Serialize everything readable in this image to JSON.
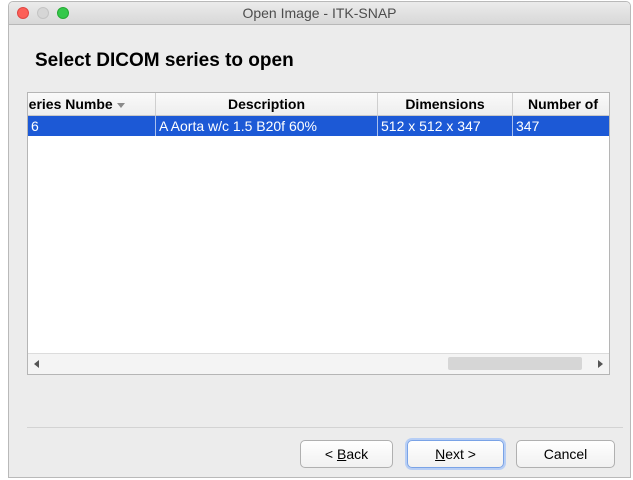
{
  "window": {
    "title": "Open Image - ITK-SNAP"
  },
  "page": {
    "heading": "Select DICOM series to open"
  },
  "table": {
    "columns": [
      "Series Number",
      "Description",
      "Dimensions",
      "Number of"
    ],
    "column_display": [
      "ːeries Numbe",
      "Description",
      "Dimensions",
      "Number of"
    ],
    "sorted_column": "Series Number",
    "rows": [
      {
        "series_number": "6",
        "description": "A Aorta w/c  1.5  B20f  60%",
        "dimensions": "512 x 512 x 347",
        "number_of": "347",
        "selected": true
      }
    ]
  },
  "buttons": {
    "back": "< Back",
    "back_mnemonic": "B",
    "next": "Next >",
    "next_mnemonic": "N",
    "cancel": "Cancel"
  },
  "colors": {
    "selection": "#1c59d6",
    "close": "#fc5f57",
    "maximize": "#34c84a"
  }
}
